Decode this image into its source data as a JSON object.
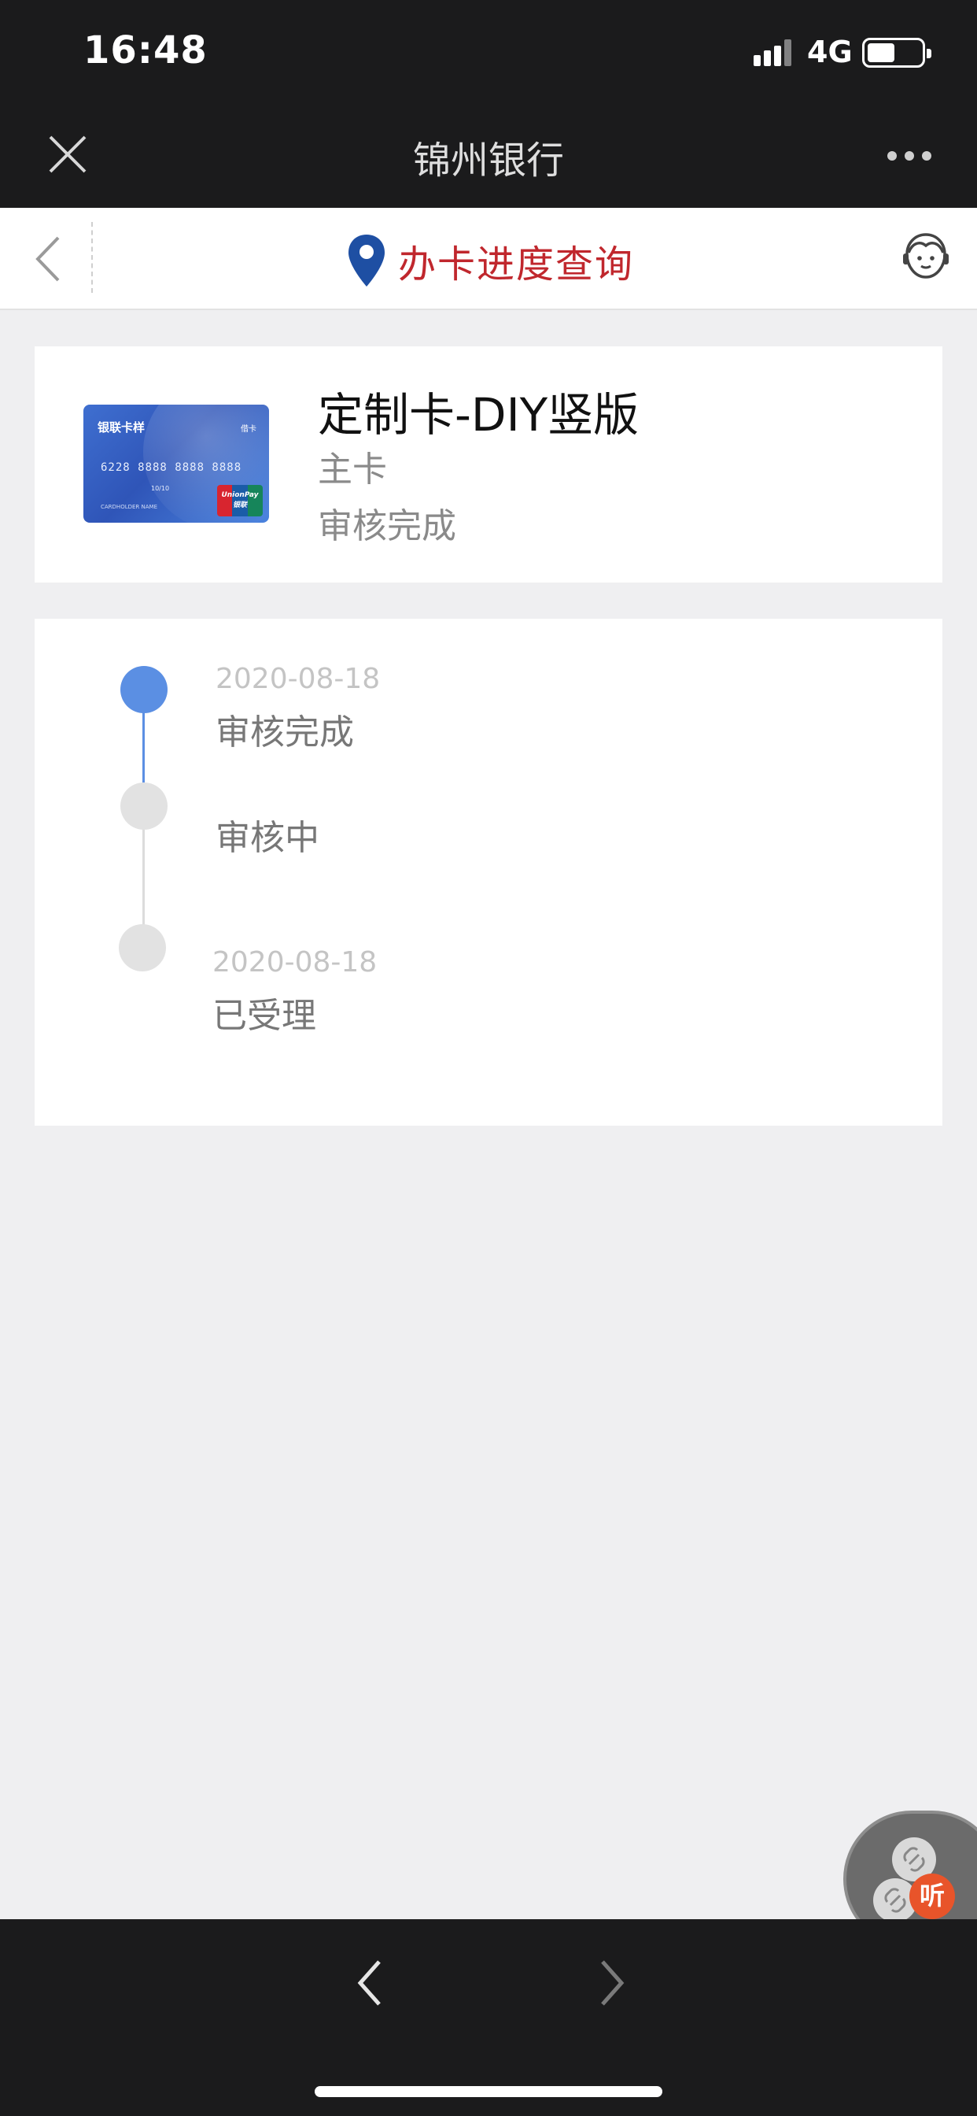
{
  "status_bar": {
    "time": "16:48",
    "network": "4G",
    "battery_level": 0.5
  },
  "wechat_bar": {
    "title": "锦州银行"
  },
  "header": {
    "title": "办卡进度查询",
    "accent_color": "#c0272d"
  },
  "card": {
    "name": "定制卡-DIY竖版",
    "type": "主卡",
    "status": "审核完成",
    "image": {
      "brand": "银联卡样",
      "kind": "借卡",
      "number": "6228 8888 8888 8888",
      "expiry": "10/10",
      "holder": "CARDHOLDER NAME",
      "network_text": "UnionPay 银联"
    }
  },
  "timeline": [
    {
      "date": "2020-08-18",
      "label": "审核完成",
      "active": true
    },
    {
      "date": "",
      "label": "审核中",
      "active": false
    },
    {
      "date": "2020-08-18",
      "label": "已受理",
      "active": false
    }
  ],
  "listen_button": {
    "label": "听"
  },
  "colors": {
    "active_dot": "#5b8fe3",
    "inactive_dot": "#e2e2e2"
  }
}
